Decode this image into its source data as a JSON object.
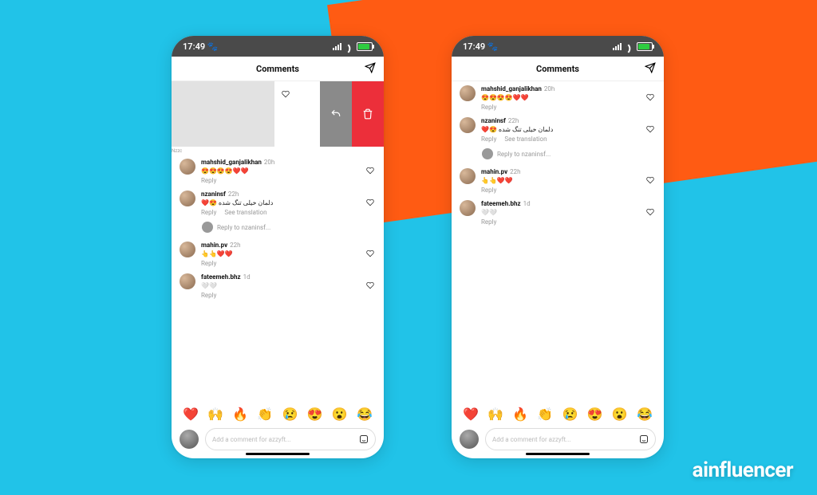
{
  "status": {
    "time": "17:49",
    "icon": "🐾"
  },
  "header": {
    "title": "Comments"
  },
  "composer": {
    "placeholder": "Add a comment for azzyft..."
  },
  "emoji_bar": [
    "❤️",
    "🙌",
    "🔥",
    "👏",
    "😢",
    "😍",
    "😮",
    "😂"
  ],
  "brand": "ainfluencer",
  "left": {
    "swiped_caption": "Nzzc",
    "comments": [
      {
        "user": "mahshid_ganjalikhan",
        "time": "20h",
        "text": "😍😍😍😍❤️❤️",
        "reply": "Reply"
      },
      {
        "user": "nzaninsf",
        "time": "22h",
        "text": "❤️😍 دلمان خیلی تنگ شده",
        "reply": "Reply",
        "see_trans": "See translation",
        "nested_reply_to": "Reply to nzaninsf..."
      },
      {
        "user": "mahin.pv",
        "time": "22h",
        "text": "👆👆❤️❤️",
        "reply": "Reply"
      },
      {
        "user": "fateemeh.bhz",
        "time": "1d",
        "text": "🤍🤍",
        "reply": "Reply"
      }
    ]
  },
  "right": {
    "comments": [
      {
        "user": "mahshid_ganjalikhan",
        "time": "20h",
        "text": "😍😍😍😍❤️❤️",
        "reply": "Reply"
      },
      {
        "user": "nzaninsf",
        "time": "22h",
        "text": "❤️😍 دلمان خیلی تنگ شده",
        "reply": "Reply",
        "see_trans": "See translation",
        "nested_reply_to": "Reply to nzaninsf..."
      },
      {
        "user": "mahin.pv",
        "time": "22h",
        "text": "👆👆❤️❤️",
        "reply": "Reply"
      },
      {
        "user": "fateemeh.bhz",
        "time": "1d",
        "text": "🤍🤍",
        "reply": "Reply"
      }
    ]
  }
}
